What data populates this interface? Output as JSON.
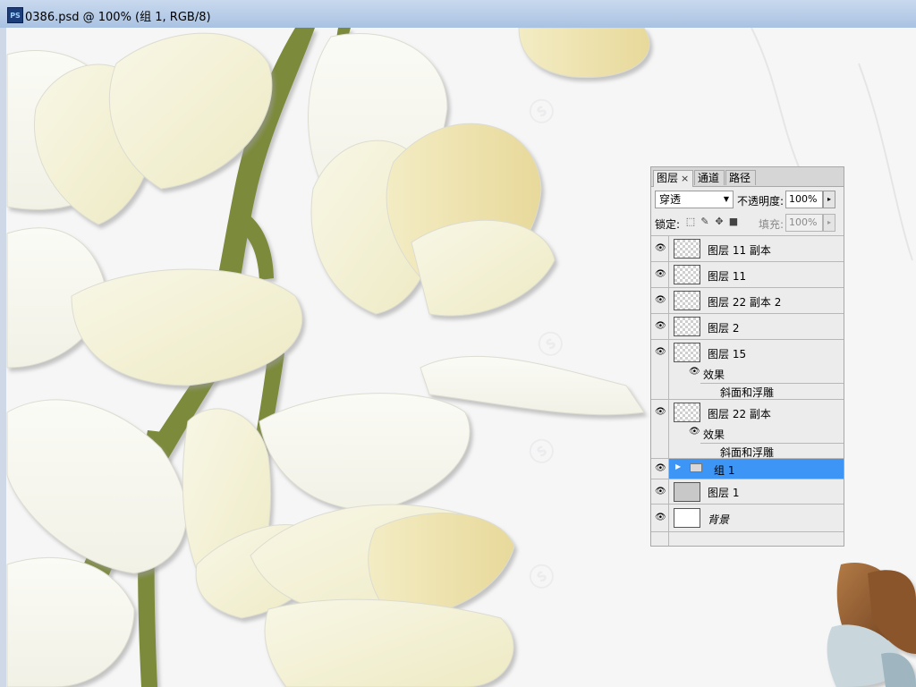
{
  "window": {
    "app_icon": "PS",
    "title": "0386.psd @ 100% (组 1, RGB/8)"
  },
  "layers_panel": {
    "tabs": [
      {
        "label": "图层",
        "close": "×"
      },
      {
        "label": "通道"
      },
      {
        "label": "路径"
      }
    ],
    "blend_mode": "穿透",
    "opacity_label": "不透明度:",
    "opacity_value": "100%",
    "lock_label": "锁定:",
    "fill_label": "填充:",
    "fill_value": "100%",
    "effects_label": "效果",
    "bevel_label": "斜面和浮雕",
    "layers": [
      {
        "name": "图层 11 副本"
      },
      {
        "name": "图层 11"
      },
      {
        "name": "图层 22 副本 2"
      },
      {
        "name": "图层 2"
      },
      {
        "name": "图层 15"
      },
      {
        "name": "图层 22 副本"
      },
      {
        "name": "组 1"
      },
      {
        "name": "图层 1"
      },
      {
        "name": "背景"
      }
    ]
  },
  "colors": {
    "selection": "#3d95f6",
    "stem": "#7c8a3c",
    "petal": "#f4f2dc"
  }
}
